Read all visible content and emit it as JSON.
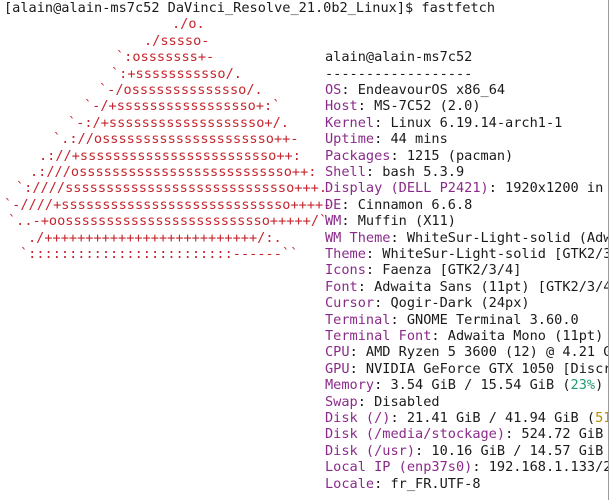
{
  "prompt": {
    "text": "[alain@alain-ms7c52 DaVinci_Resolve_21.0b2_Linux]$ fastfetch"
  },
  "logo_lines": [
    "./o.",
    "./sssso-",
    "`:osssssss+-",
    "`:+sssssssssso/.",
    "`-/ossssssssssssso/.",
    "`-/+sssssssssssssssso+:`",
    "`-:/+sssssssssssssssssso+/.",
    "`.://osssssssssssssssssssso++-",
    ".://+ssssssssssssssssssssssso++:",
    ".:///ossssssssssssssssssssssssso++:",
    "`:////ssssssssssssssssssssssssssso+++.",
    "`-////+ssssssssssssssssssssssssssso++++-",
    "`..-+oosssssssssssssssssssssssso+++++/`",
    "./++++++++++++++++++++++++++/:.",
    "`:::::::::::::::::::::::::------``"
  ],
  "info": {
    "user_host": "alain@alain-ms7c52",
    "separator": "------------------",
    "rows": [
      {
        "key": "OS",
        "value": ": EndeavourOS x86_64"
      },
      {
        "key": "Host",
        "value": ": MS-7C52 (2.0)"
      },
      {
        "key": "Kernel",
        "value": ": Linux 6.19.14-arch1-1"
      },
      {
        "key": "Uptime",
        "value": ": 44 mins"
      },
      {
        "key": "Packages",
        "value": ": 1215 (pacman)"
      },
      {
        "key": "Shell",
        "value": ": bash 5.3.9"
      },
      {
        "key": "Display (DELL P2421)",
        "value": ": 1920x1200 in ]"
      },
      {
        "key": "DE",
        "value": ": Cinnamon 6.6.8"
      },
      {
        "key": "WM",
        "value": ": Muffin (X11)"
      },
      {
        "key": "WM Theme",
        "value": ": WhiteSur-Light-solid (Adw)"
      },
      {
        "key": "Theme",
        "value": ": WhiteSur-Light-solid [GTK2/3]"
      },
      {
        "key": "Icons",
        "value": ": Faenza [GTK2/3/4]"
      },
      {
        "key": "Font",
        "value": ": Adwaita Sans (11pt) [GTK2/3/4]"
      },
      {
        "key": "Cursor",
        "value": ": Qogir-Dark (24px)"
      },
      {
        "key": "Terminal",
        "value": ": GNOME Terminal 3.60.0"
      },
      {
        "key": "Terminal Font",
        "value": ": Adwaita Mono (11pt)"
      },
      {
        "key": "CPU",
        "value": ": AMD Ryzen 5 3600 (12) @ 4.21 Gz"
      },
      {
        "key": "GPU",
        "value": ": NVIDIA GeForce GTX 1050 [Discr]"
      }
    ],
    "memory": {
      "key": "Memory",
      "value": ": 3.54 GiB / 15.54 GiB (",
      "pct": "23%",
      "tail": ")"
    },
    "swap": {
      "key": "Swap",
      "value": ": Disabled"
    },
    "disk_root": {
      "key": "Disk (/)",
      "value": ": 21.41 GiB / 41.94 GiB (",
      "pct": "514"
    },
    "disk_stockage": {
      "key": "Disk (/media/stockage)",
      "value": ": 524.72 GiB k"
    },
    "disk_usr": {
      "key": "Disk (/usr)",
      "value": ": 10.16 GiB / 14.57 GiB 4"
    },
    "local_ip": {
      "key": "Local IP (enp37s0)",
      "value": ": 192.168.1.133/24"
    },
    "locale": {
      "key": "Locale",
      "value": ": fr_FR.UTF-8"
    }
  },
  "colors": {
    "logo_red": "#c4262e",
    "logo_purple": "#8a2b8a",
    "key_purple": "#8a2b8a",
    "title_red": "#b31b1b",
    "percent_green": "#1f9a74",
    "percent_yellow": "#b88a00"
  }
}
